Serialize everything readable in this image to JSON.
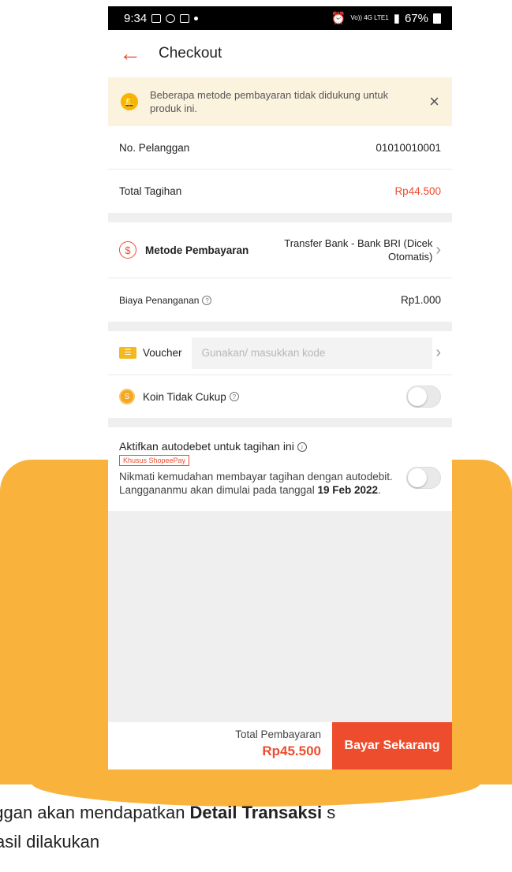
{
  "status": {
    "time": "9:34",
    "signal_text": "Vo)) 4G LTE1",
    "battery": "67%"
  },
  "header": {
    "title": "Checkout",
    "back_arrow": "←"
  },
  "banner": {
    "text": "Beberapa metode pembayaran tidak didukung untuk produk ini.",
    "close": "×"
  },
  "customer": {
    "label": "No. Pelanggan",
    "value": "01010010001"
  },
  "bill": {
    "label": "Total Tagihan",
    "value": "Rp44.500"
  },
  "payment": {
    "label": "Metode Pembayaran",
    "value": "Transfer Bank - Bank BRI (Dicek Otomatis)",
    "icon": "$"
  },
  "fee": {
    "label": "Biaya Penanganan",
    "value": "Rp1.000"
  },
  "voucher": {
    "label": "Voucher",
    "placeholder": "Gunakan/ masukkan kode"
  },
  "coin": {
    "label": "Koin Tidak Cukup"
  },
  "autodebit": {
    "title": "Aktifkan autodebet untuk tagihan ini",
    "badge": "Khusus ShopeePay",
    "desc": "Nikmati kemudahan membayar tagihan dengan autodebit. Langgananmu akan dimulai pada tanggal ",
    "date": "19 Feb 2022",
    "period": "."
  },
  "footer": {
    "total_label": "Total Pembayaran",
    "total_value": "Rp45.500",
    "pay_button": "Bayar Sekarang"
  },
  "caption": {
    "line1_pre": "nggan akan mendapatkan ",
    "line1_bold": "Detail Transaksi",
    "line1_post": " s",
    "line2": "asil dilakukan"
  },
  "colors": {
    "accent": "#ee4d2d",
    "background_shape": "#f9b23b",
    "banner_bg": "#fcf3df"
  }
}
